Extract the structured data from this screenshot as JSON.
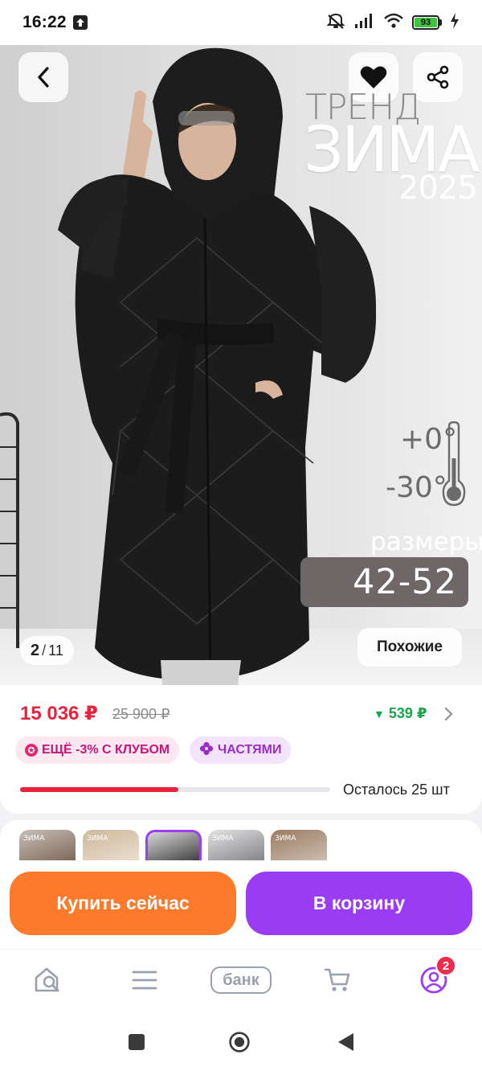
{
  "status_bar": {
    "time": "16:22",
    "battery": "93"
  },
  "gallery": {
    "counter_current": "2",
    "counter_separator": "/",
    "counter_total": "11",
    "similar_label": "Похожие",
    "promo": {
      "trend": "ТРЕНД",
      "season": "ЗИМА",
      "year": "2025",
      "temp_high": "+0°",
      "temp_low": "-30°",
      "sizes_label": "размеры:",
      "sizes_value": "42-52"
    }
  },
  "price": {
    "current": "15 036 ₽",
    "old": "25 900 ₽",
    "cashback": "539 ₽"
  },
  "badges": {
    "club": "ЕЩЁ -3% С КЛУБОМ",
    "installments": "ЧАСТЯМИ"
  },
  "stock": {
    "text": "Осталось 25 шт",
    "fraction_remaining": 0.51
  },
  "variants": {
    "tags": [
      "ЗИМА",
      "ЗИМА",
      "",
      "ЗИМА",
      "ЗИМА"
    ],
    "selected_index": 2
  },
  "actions": {
    "buy_now": "Купить сейчас",
    "add_to_cart": "В корзину"
  },
  "tab_bar": {
    "bank_label": "банк",
    "profile_badge": "2"
  },
  "colors": {
    "price_red": "#e8233b",
    "cashback_green": "#1aa548",
    "buy_orange": "#fb7a2c",
    "cart_purple": "#9a3cf4"
  }
}
